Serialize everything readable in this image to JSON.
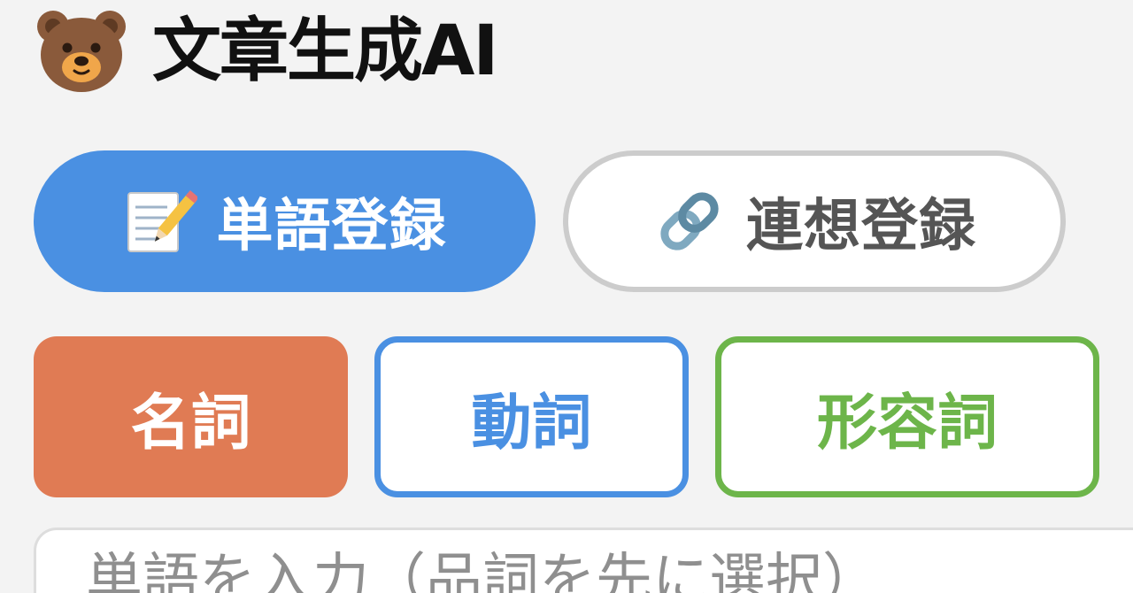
{
  "header": {
    "title": "文章生成AI",
    "logo_icon": "bear-face-icon"
  },
  "tabs": [
    {
      "label": "単語登録",
      "icon": "memo-pencil-icon",
      "active": true
    },
    {
      "label": "連想登録",
      "icon": "link-icon",
      "active": false
    }
  ],
  "pos_buttons": [
    {
      "label": "名詞",
      "color": "#e07b54",
      "selected": true
    },
    {
      "label": "動詞",
      "color": "#4a90e2",
      "selected": false
    },
    {
      "label": "形容詞",
      "color": "#6db54a",
      "selected": false
    }
  ],
  "input": {
    "placeholder": "単語を入力（品詞を先に選択）",
    "value": ""
  },
  "colors": {
    "accent_blue": "#4a90e2",
    "noun_orange": "#e07b54",
    "adjective_green": "#6db54a",
    "background": "#f3f3f3"
  }
}
